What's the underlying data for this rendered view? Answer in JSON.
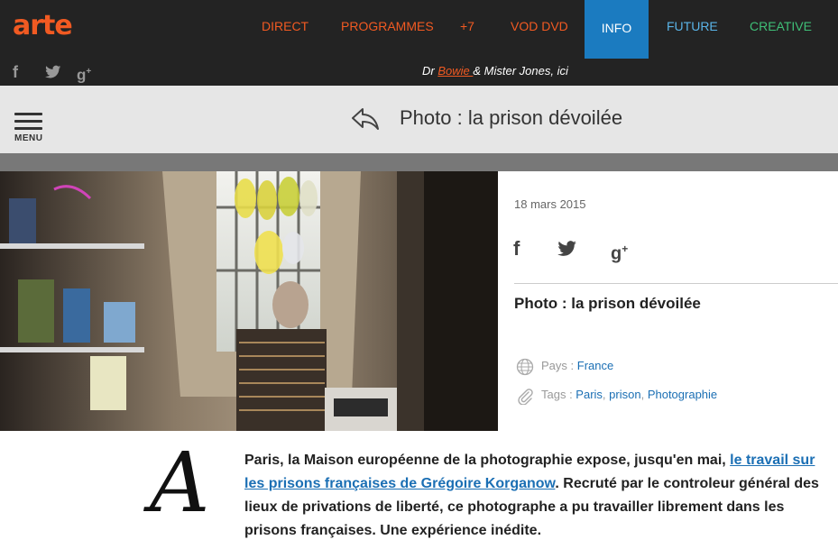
{
  "brand": {
    "logo": "arte",
    "accent": "#f15a22"
  },
  "nav": {
    "items": [
      {
        "label": "DIRECT"
      },
      {
        "label": "PROGRAMMES"
      },
      {
        "label": "+7"
      },
      {
        "label": "VOD DVD"
      },
      {
        "label": "INFO",
        "active": true
      },
      {
        "label": "FUTURE"
      },
      {
        "label": "CREATIVE"
      }
    ]
  },
  "social_top": {
    "icons": [
      "facebook-icon",
      "twitter-icon",
      "google-plus-icon"
    ]
  },
  "promo": {
    "prefix": "Dr ",
    "link": "Bowie ",
    "suffix": "& Mister Jones, ici"
  },
  "titlebar": {
    "menu_label": "MENU",
    "title": "Photo : la prison dévoilée"
  },
  "article": {
    "date": "18 mars 2015",
    "share_icons": [
      "facebook-icon",
      "twitter-icon",
      "google-plus-icon"
    ],
    "title": "Photo : la prison dévoilée",
    "pays_label": "Pays : ",
    "pays": "France",
    "tags_label": "Tags : ",
    "tags": [
      "Paris",
      "prison",
      "Photographie"
    ],
    "dropcap": "A",
    "lead_before": "Paris, la Maison européenne de la photographie expose, jusqu'en mai, ",
    "lead_link": "le travail sur les prisons françaises de Grégoire Korganow",
    "lead_after": ". Recruté par le controleur général des lieux de privations de liberté, ce photographe a pu travailler librement dans les prisons françaises. Une expérience inédite."
  }
}
